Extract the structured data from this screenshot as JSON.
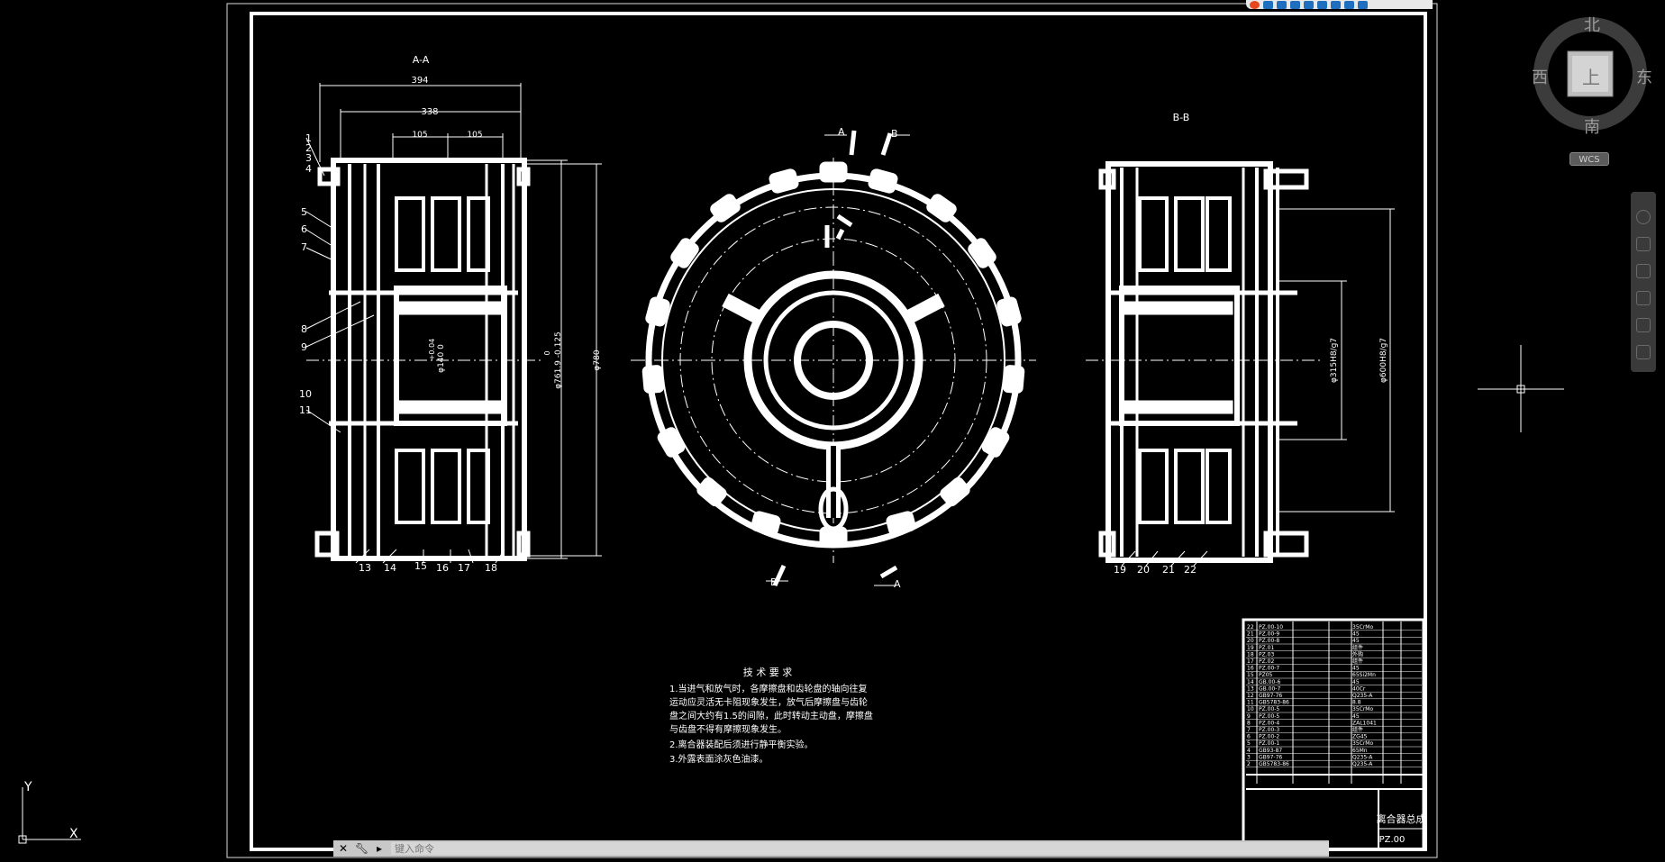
{
  "sections": {
    "aa": "A-A",
    "bb": "B-B",
    "cut_a_top": "A",
    "cut_b_top": "B",
    "cut_b_bottom": "B",
    "cut_a_bottom": "A"
  },
  "dims": {
    "d394": "394",
    "d338": "338",
    "d105a": "105",
    "d105b": "105",
    "phi780": "φ780",
    "phi761": "φ761.9 -0.125",
    "phi761_zero": "0",
    "phi140": "φ140 0",
    "phi140_tol": "+0.04",
    "phi315": "φ315H8/g7",
    "phi600": "φ600H8/g7"
  },
  "balloons_left": [
    "1",
    "2",
    "3",
    "4",
    "5",
    "6",
    "7",
    "8",
    "9",
    "10",
    "11"
  ],
  "balloons_bottom_left": [
    "13",
    "14",
    "15",
    "16",
    "17",
    "18"
  ],
  "balloons_bottom_right": [
    "19",
    "20",
    "21",
    "22"
  ],
  "tech_req": {
    "title": "技 术 要 求",
    "lines": [
      "1.当进气和放气时，各摩擦盘和齿轮盘的轴向往复",
      "运动应灵活无卡阻现象发生，放气后摩擦盘与齿轮",
      "盘之间大约有1.5的间隙，此时转动主动盘，摩擦盘",
      "与齿盘不得有摩擦现象发生。",
      "2.离合器装配后须进行静平衡实验。",
      "3.外露表面涂灰色油漆。"
    ]
  },
  "bom_rows": [
    [
      "22",
      "PZ.00-10",
      "",
      "35CrMo"
    ],
    [
      "21",
      "PZ.00-9",
      "",
      "45"
    ],
    [
      "20",
      "PZ.00-8",
      "",
      "45"
    ],
    [
      "19",
      "PZ.01",
      "",
      "组件"
    ],
    [
      "18",
      "PZ.03",
      "",
      "外购"
    ],
    [
      "17",
      "PZ.02",
      "",
      "组件"
    ],
    [
      "16",
      "PZ.00-7",
      "",
      "45"
    ],
    [
      "15",
      "PZ05",
      "",
      "65Si2Mn"
    ],
    [
      "14",
      "GB.00-6",
      "",
      "45"
    ],
    [
      "13",
      "GB.00-7",
      "",
      "40Cr"
    ],
    [
      "12",
      "GB97-76",
      "",
      "Q235-A"
    ],
    [
      "11",
      "GB5783-86",
      "",
      "8.8"
    ],
    [
      "10",
      "PZ.00-5",
      "",
      "35CrMo"
    ],
    [
      "9",
      "PZ.00-5",
      "",
      "45"
    ],
    [
      "8",
      "PZ.00-4",
      "",
      "ZAL1041"
    ],
    [
      "7",
      "PZ.00-3",
      "",
      "组件"
    ],
    [
      "6",
      "PZ.00-2",
      "",
      "ZG45"
    ],
    [
      "5",
      "PZ.00-1",
      "",
      "35CrMo"
    ],
    [
      "4",
      "GB93-87",
      "",
      "65Mn"
    ],
    [
      "3",
      "GB97-76",
      "",
      "Q235-A"
    ],
    [
      "2",
      "GB5783-86",
      "",
      "Q235-A"
    ]
  ],
  "title_block": {
    "name": "离合器总成",
    "drawing_no": "PZ.00"
  },
  "viewcube": {
    "north": "北",
    "south": "南",
    "west": "西",
    "east": "东",
    "top": "上",
    "wcs": "WCS"
  },
  "ucs": {
    "x": "X",
    "y": "Y"
  },
  "command": {
    "placeholder": "键入命令"
  },
  "colors": {
    "background": "#000000",
    "lines": "#ffffff",
    "cmdbar": "#c8c8c8"
  }
}
